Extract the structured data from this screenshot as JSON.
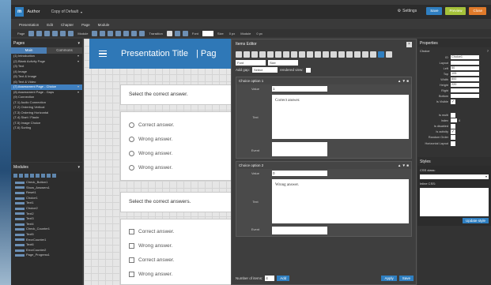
{
  "app": {
    "logo": "m",
    "name": "Author",
    "project": "Copy of Default",
    "project_caret": "▾"
  },
  "titlebar": {
    "settings": "Settings",
    "buttons": [
      {
        "label": "Save",
        "color": "#2f7fc1"
      },
      {
        "label": "Preview",
        "color": "#a5c23a"
      },
      {
        "label": "Close",
        "color": "#e07a2a"
      }
    ]
  },
  "menu": [
    "Presentation",
    "Edit",
    "Chapter",
    "Page",
    "Module"
  ],
  "toolbar": {
    "page": "Page",
    "module": "Module",
    "transition": "Transition",
    "font": "Font",
    "size": "Size",
    "size_value": "0 px",
    "module_label": "Module",
    "module_value": "0 px"
  },
  "pages": {
    "title": "Pages",
    "tabs": [
      "Main",
      "Commons"
    ],
    "items": [
      "(1) Introduction",
      "(2) Blank Activity Page",
      "(3) Text",
      "(4) Image",
      "(5) Text & Image",
      "(6) Text & Video",
      "(7) Assessment Page - Choice",
      "(8) Assessment Page - Gaps",
      "(9) Connection",
      "(T-1) Audio Connection",
      "(T-2) Ordering Vertical",
      "(T-3) Ordering Horizontal",
      "(T-4) Start / Flashr",
      "(T-5) Image Choice",
      "(T-6) Sorting"
    ],
    "active_index": 6
  },
  "modules": {
    "title": "Modules",
    "items": [
      "Check_Button1",
      "Show_Answers1",
      "Reset1",
      "Choice1",
      "Text1",
      "Choice2",
      "Text2",
      "Text3",
      "Text4",
      "Check_Counter1",
      "Text5",
      "ErrorCounter1",
      "Text6",
      "ErrorCounter2",
      "Page_Progress1"
    ]
  },
  "canvas": {
    "title": "Presentation Title",
    "separator": "|",
    "page": "Pag",
    "question1": "Select the correct answer.",
    "options1": [
      "Correct answer.",
      "Wrong answer.",
      "Wrong answer.",
      "Wrong answer."
    ],
    "question2": "Select the correct answers.",
    "options2": [
      "Correct answer.",
      "Wrong answer.",
      "Correct answer.",
      "Wrong answer."
    ]
  },
  "editor": {
    "title": "Items Editor",
    "close": "×",
    "font": "Font",
    "size": "Size",
    "add_gap": "Add gap:",
    "gap_value": "Select",
    "rendered_view": "rendered view:",
    "choices": [
      {
        "title": "Choice option 1",
        "value_label": "Value",
        "value": "1",
        "text_label": "Text",
        "text": "Correct answer.",
        "event_label": "Event"
      },
      {
        "title": "Choice option 2",
        "value_label": "Value",
        "value": "0",
        "text_label": "Text",
        "text": "Wrong answer.",
        "event_label": "Event"
      }
    ],
    "footer": {
      "number_label": "Number of items:",
      "number": "4",
      "add": "Add",
      "apply": "Apply",
      "save": "Save"
    }
  },
  "props": {
    "title": "Properties",
    "subtitle": "Choice",
    "rows": [
      {
        "label": "ID",
        "value": "Choice1"
      },
      {
        "label": "Layout",
        "value": ""
      },
      {
        "label": "Left",
        "value": "50"
      },
      {
        "label": "Top",
        "value": "105"
      },
      {
        "label": "Width",
        "value": "800"
      },
      {
        "label": "Height",
        "value": "220"
      },
      {
        "label": "Right",
        "value": ""
      },
      {
        "label": "Bottom",
        "value": ""
      }
    ],
    "checks": [
      {
        "label": "Is Visible",
        "checked": "✓"
      },
      {
        "label": "Is multi",
        "checked": ""
      },
      {
        "label": "Is disabled",
        "checked": ""
      },
      {
        "label": "Is activity",
        "checked": "✓"
      },
      {
        "label": "Random Order",
        "checked": ""
      },
      {
        "label": "Horizontal Layout",
        "checked": ""
      }
    ],
    "index_label": "Index",
    "index_value": "4",
    "styles_title": "Styles",
    "css_class": "CSS class:",
    "inline_css": "Inline CSS:",
    "update": "Update style"
  }
}
